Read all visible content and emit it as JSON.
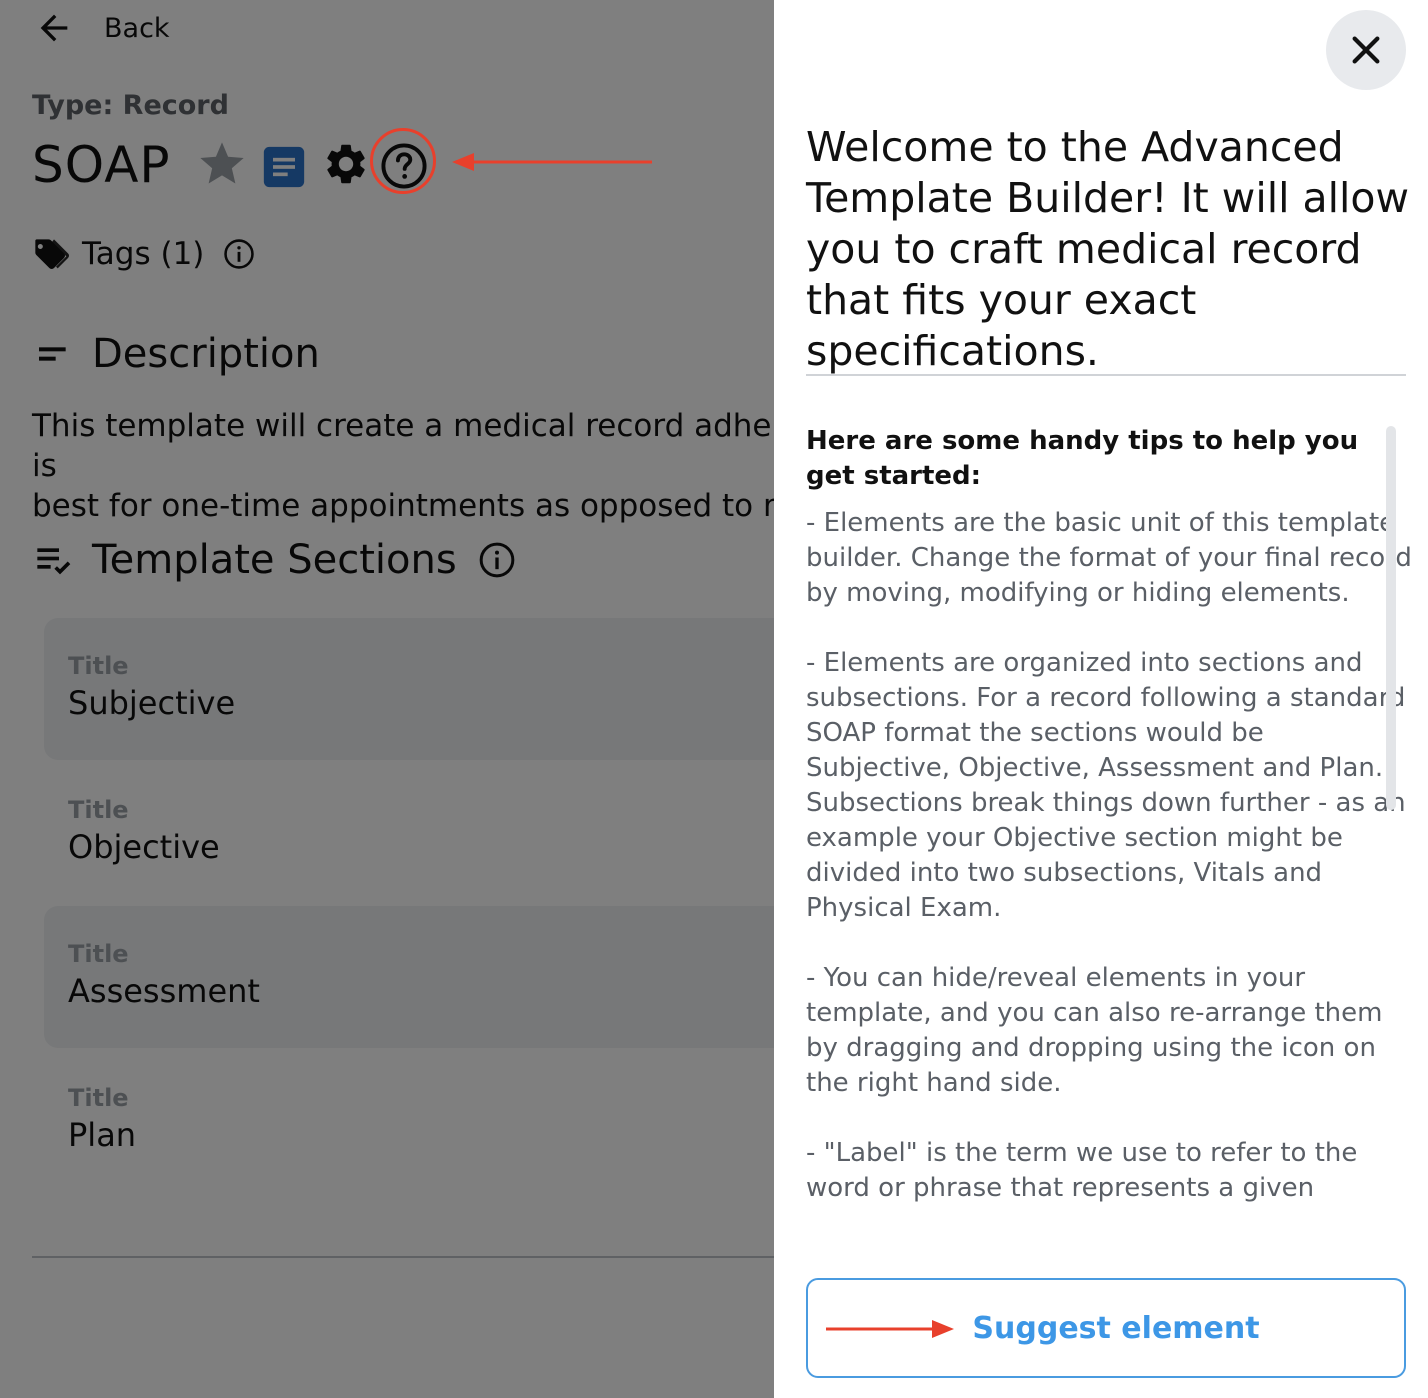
{
  "header": {
    "back_label": "Back",
    "type_label": "Type: Record",
    "title": "SOAP",
    "tags_label": "Tags (1)"
  },
  "description": {
    "heading": "Description",
    "text": "This template will create a medical record adhering to the SOAP format. This is\nbest for one-time appointments as opposed to multi-visit treatment plans."
  },
  "template_sections": {
    "heading": "Template Sections",
    "field_label": "Title",
    "items": [
      {
        "label": "Title",
        "value": "Subjective"
      },
      {
        "label": "Title",
        "value": "Objective"
      },
      {
        "label": "Title",
        "value": "Assessment"
      },
      {
        "label": "Title",
        "value": "Plan"
      }
    ]
  },
  "drawer": {
    "welcome": "Welcome to the Advanced Template Builder! It will allow you to craft medical record that fits your exact specifications.",
    "tips_heading": "Here are some handy tips to help you get started:",
    "tips": [
      "- Elements are the basic unit of this template builder. Change the format of your final record by moving, modifying or hiding elements.",
      "- Elements are organized into sections and subsections. For a record following a standard SOAP format the sections would be Subjective, Objective, Assessment and Plan. Subsections break things down further - as an example your Objective section might be divided into two subsections, Vitals and Physical Exam.",
      "- You can hide/reveal elements in your template, and you can also re-arrange them by dragging and dropping using the icon on the right hand side.",
      "- \"Label\" is the term we use to refer to the word or phrase that represents a given"
    ],
    "suggest_label": "Suggest element"
  },
  "colors": {
    "accent": "#3d97e6",
    "annotation_red": "#e8402c",
    "doc_icon_blue": "#2b73c9",
    "overlay": "rgba(0,0,0,0.5)"
  },
  "icons": {
    "back": "arrow-left-icon",
    "favorite": "star-icon",
    "document": "document-icon",
    "settings": "gear-icon",
    "help": "help-circle-icon",
    "tags": "tag-icon",
    "info": "info-icon",
    "description": "notes-icon",
    "sections": "checklist-icon",
    "close": "close-icon"
  }
}
